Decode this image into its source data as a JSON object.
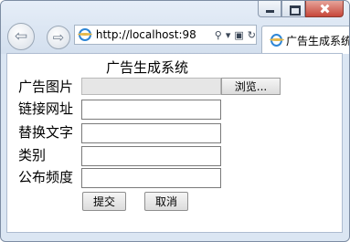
{
  "browser": {
    "url": "http://localhost:98",
    "tab_title": "广告生成系统",
    "back_glyph": "⇦",
    "forward_glyph": "⇨",
    "search_glyph": "⚲",
    "dropdown_glyph": "▾",
    "compat_glyph": "▣",
    "refresh_glyph": "↻"
  },
  "icons": [
    "ie-icon",
    "search-icon",
    "refresh-icon",
    "compat-view-icon",
    "back-icon",
    "forward-icon"
  ],
  "form": {
    "title": "广告生成系统",
    "image_label": "广告图片",
    "browse_label": "浏览...",
    "link_label": "链接网址",
    "link_value": "",
    "alt_label": "替换文字",
    "alt_value": "",
    "category_label": "类别",
    "category_value": "",
    "frequency_label": "公布频度",
    "frequency_value": "",
    "submit_label": "提交",
    "cancel_label": "取消"
  }
}
